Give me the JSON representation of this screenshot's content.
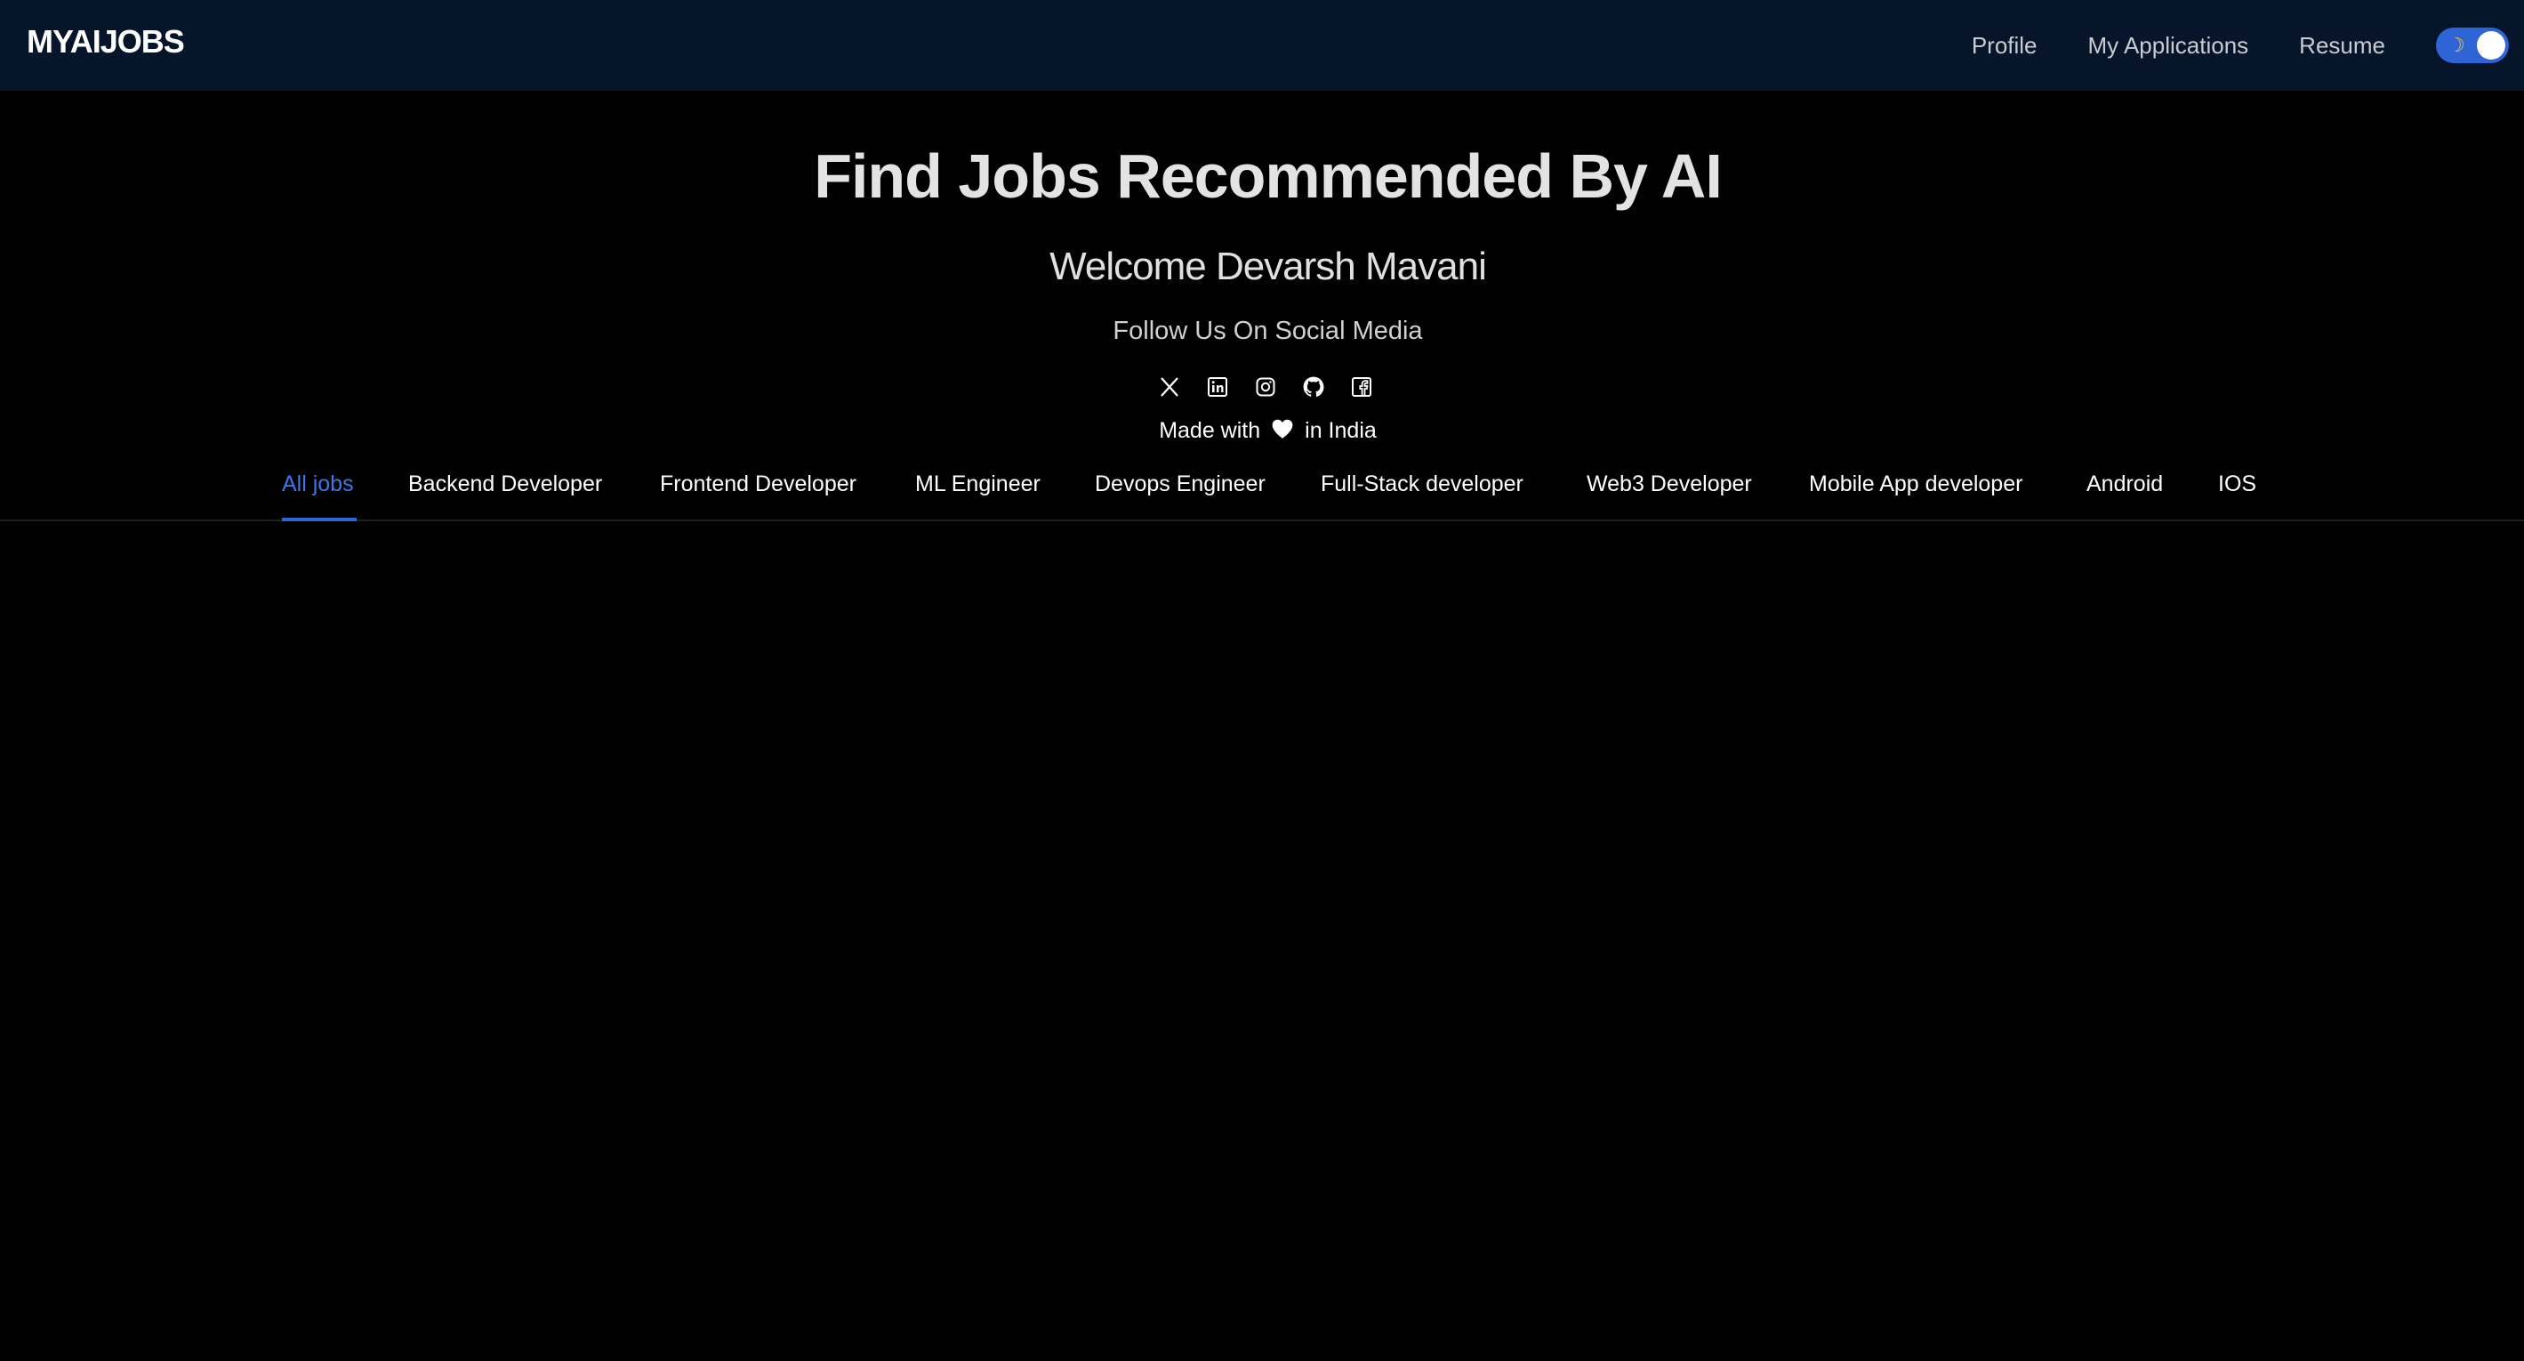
{
  "header": {
    "brand": "MYAIJOBS",
    "nav": [
      {
        "label": "Profile"
      },
      {
        "label": "My Applications"
      },
      {
        "label": "Resume"
      }
    ],
    "theme_toggle_icon": "moon-icon"
  },
  "hero": {
    "title": "Find Jobs Recommended By AI",
    "welcome": "Welcome Devarsh Mavani",
    "follow": "Follow Us On Social Media",
    "social_icons": [
      "x-icon",
      "linkedin-icon",
      "instagram-icon",
      "github-icon",
      "facebook-icon"
    ],
    "made_prefix": "Made with",
    "made_suffix": "in India"
  },
  "tabs": [
    {
      "label": "All jobs",
      "active": true
    },
    {
      "label": "Backend Developer"
    },
    {
      "label": "Frontend Developer"
    },
    {
      "label": "ML Engineer"
    },
    {
      "label": "Devops Engineer"
    },
    {
      "label": "Full-Stack developer"
    },
    {
      "label": "Web3 Developer"
    },
    {
      "label": "Mobile App developer"
    },
    {
      "label": "Android"
    },
    {
      "label": "IOS"
    }
  ],
  "colors": {
    "navbar_bg": "#06152a",
    "accent": "#2f64d6",
    "active_tab": "#3a78ea",
    "page_bg": "#000000"
  }
}
